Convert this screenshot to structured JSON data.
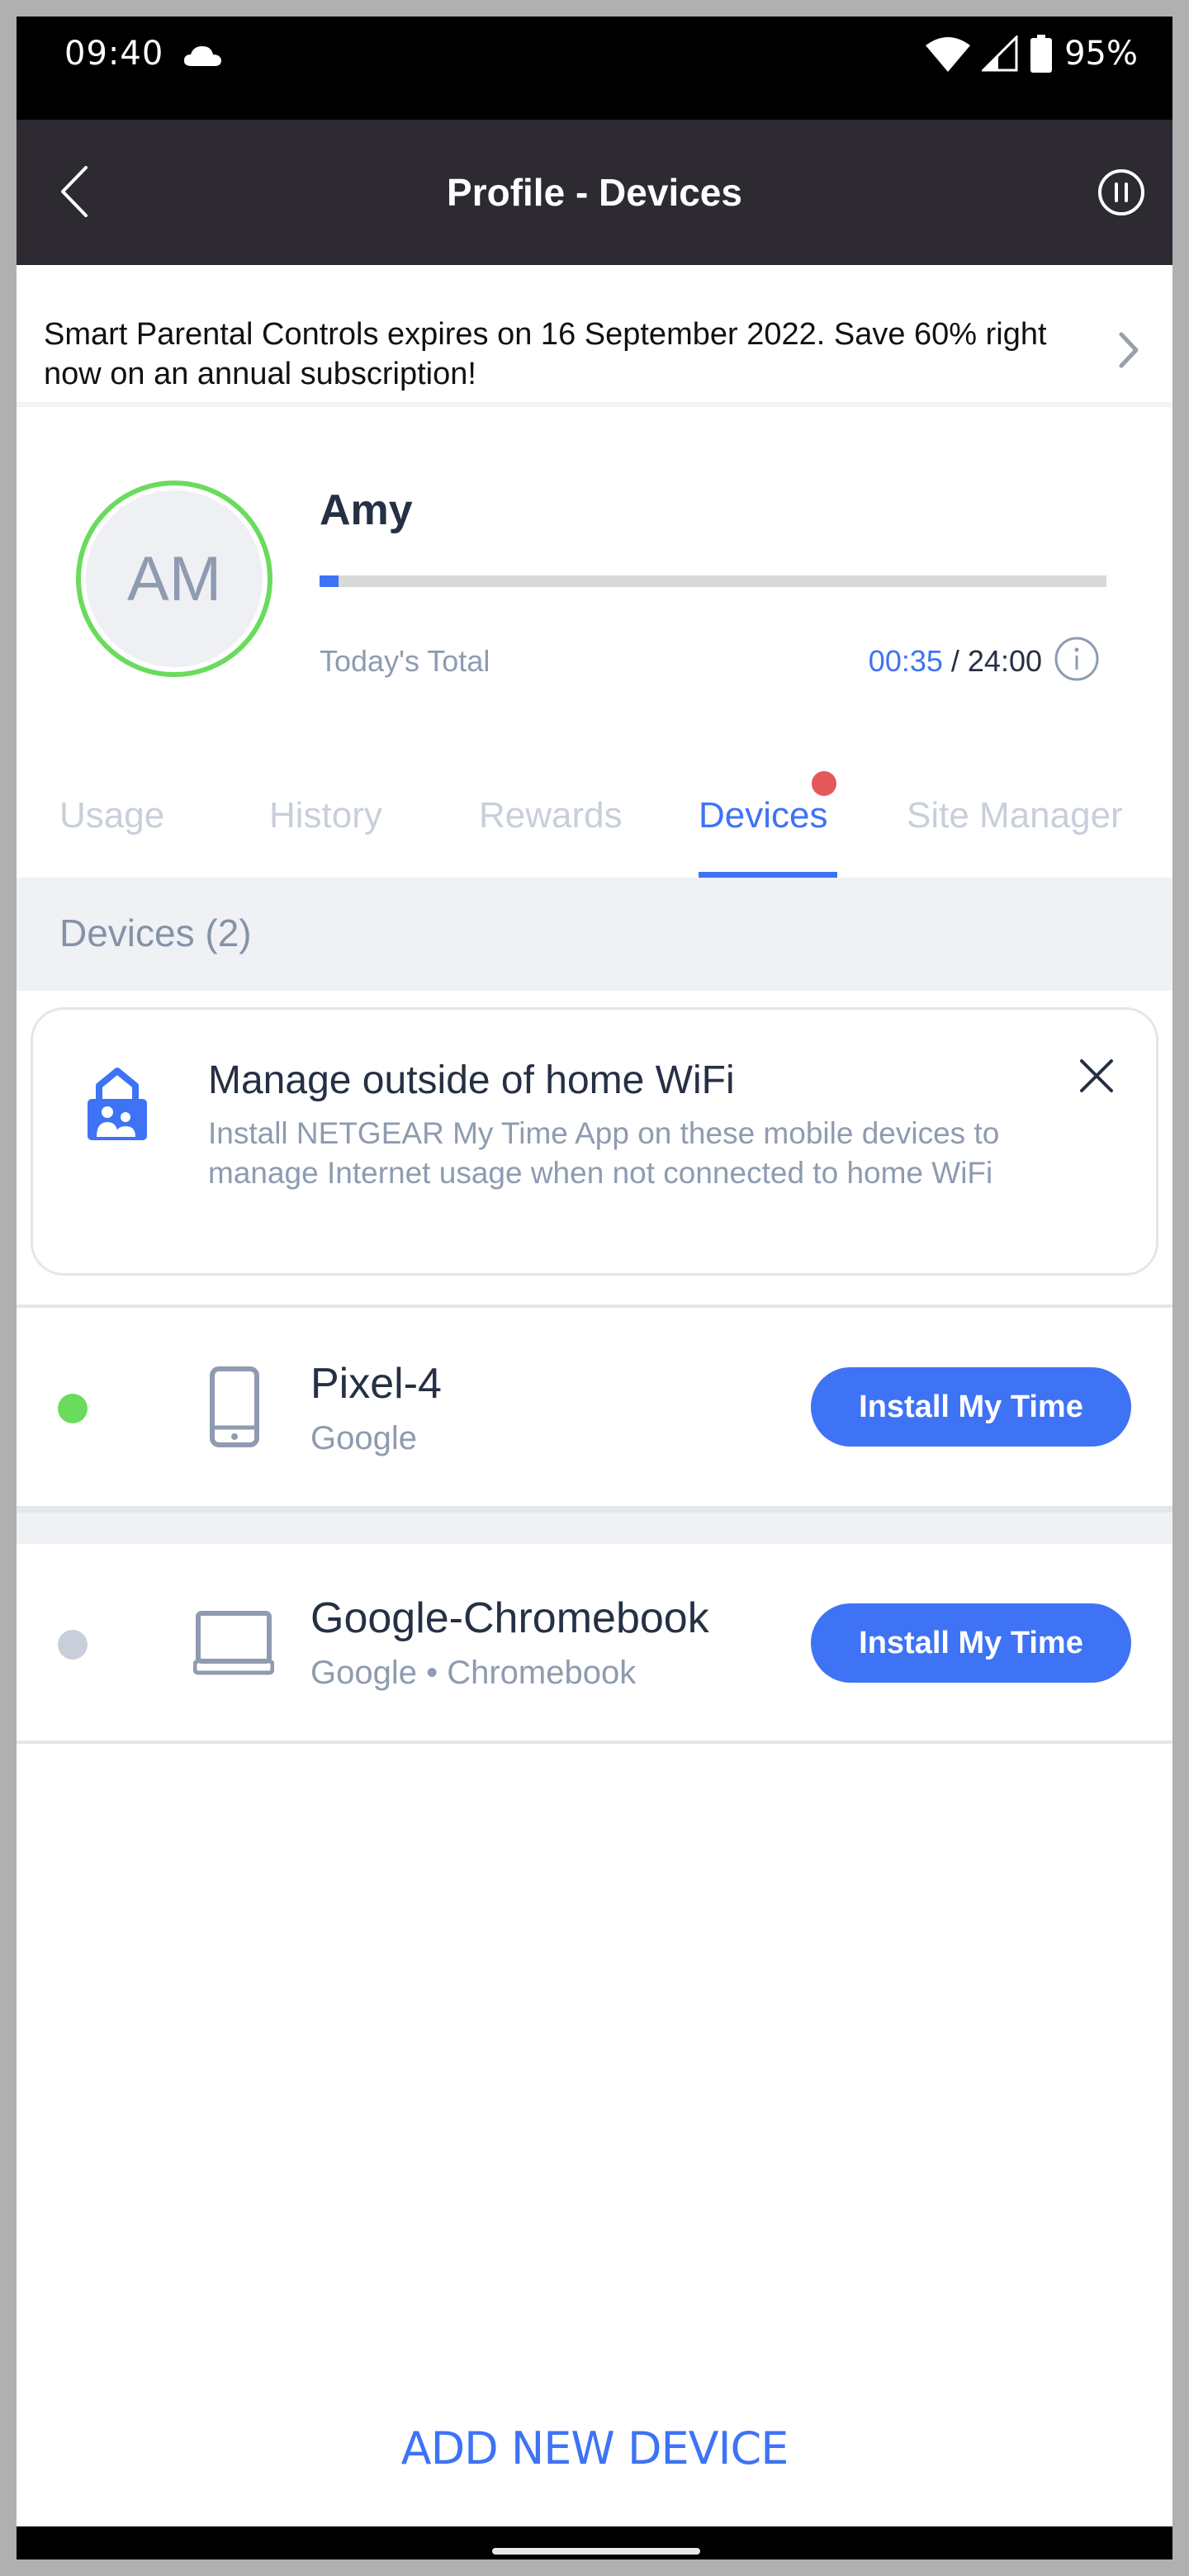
{
  "status_bar": {
    "time": "09:40",
    "weather_icon": "cloud-icon",
    "wifi_icon": "wifi-icon",
    "signal_icon": "cellular-signal-icon",
    "battery_icon": "battery-icon",
    "battery_percent": "95%"
  },
  "header": {
    "title": "Profile - Devices",
    "back_icon": "chevron-left-icon",
    "pause_icon": "pause-circle-icon"
  },
  "promo": {
    "text": "Smart Parental Controls expires on 16 September 2022. Save 60% right now on an annual subscription!",
    "chevron_icon": "chevron-right-icon"
  },
  "profile": {
    "initials": "AM",
    "name": "Amy",
    "usage_label": "Today's Total",
    "usage_current": "00:35",
    "usage_separator": " / ",
    "usage_limit": "24:00",
    "usage_fraction": 0.024,
    "info_icon": "info-icon"
  },
  "tabs": [
    {
      "label": "Usage",
      "active": false
    },
    {
      "label": "History",
      "active": false
    },
    {
      "label": "Rewards",
      "active": false
    },
    {
      "label": "Devices",
      "active": true,
      "badge": true
    },
    {
      "label": "Site Manager",
      "active": false
    }
  ],
  "section": {
    "title": "Devices (2)"
  },
  "info_card": {
    "icon": "family-lock-icon",
    "title": "Manage outside of home WiFi",
    "body": "Install NETGEAR My Time App on these mobile devices to manage Internet usage when not connected to home WiFi",
    "close_icon": "close-icon"
  },
  "devices": [
    {
      "name": "Pixel-4",
      "subtitle": "Google",
      "type_icon": "smartphone-icon",
      "online": true,
      "status_color": "#6bdb5e",
      "button_label": "Install My Time"
    },
    {
      "name": "Google-Chromebook",
      "subtitle": "Google • Chromebook",
      "type_icon": "laptop-icon",
      "online": false,
      "status_color": "#c8cfdb",
      "button_label": "Install My Time"
    }
  ],
  "footer": {
    "add_device_label": "ADD NEW DEVICE"
  },
  "colors": {
    "accent": "#3f73f5",
    "header_bg": "#2d2a31",
    "online": "#6bdb5e",
    "badge": "#e4585c"
  }
}
